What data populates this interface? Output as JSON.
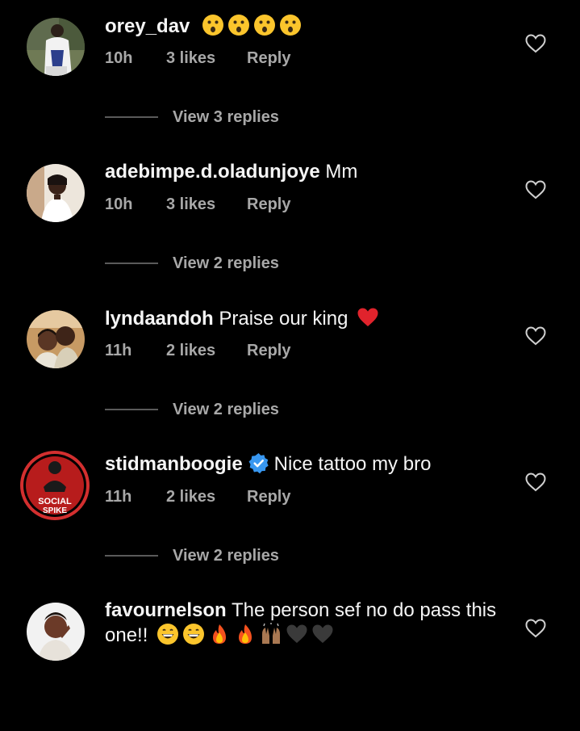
{
  "comments": [
    {
      "username": "orey_dav",
      "text": "",
      "emoji": [
        "hushed-face-icon",
        "hushed-face-icon",
        "hushed-face-icon",
        "hushed-face-icon"
      ],
      "time": "10h",
      "likes": "3 likes",
      "reply": "Reply",
      "view_replies": "View 3 replies"
    },
    {
      "username": "adebimpe.d.oladunjoye",
      "text": "Mm",
      "time": "10h",
      "likes": "3 likes",
      "reply": "Reply",
      "view_replies": "View 2 replies"
    },
    {
      "username": "lyndaandoh",
      "text": "Praise our king",
      "emoji": [
        "red-heart-icon"
      ],
      "time": "11h",
      "likes": "2 likes",
      "reply": "Reply",
      "view_replies": "View 2 replies"
    },
    {
      "username": "stidmanboogie",
      "verified": true,
      "avatar_text_line1": "SOCIAL",
      "avatar_text_line2": "SPIKE",
      "text": "Nice tattoo my bro",
      "time": "11h",
      "likes": "2 likes",
      "reply": "Reply",
      "view_replies": "View 2 replies"
    },
    {
      "username": "favournelson",
      "text_line1": "The person sef no do pass this",
      "text_line2": "one!!",
      "emoji": [
        "grinning-face-icon",
        "grinning-face-icon",
        "fire-icon",
        "fire-icon",
        "raising-hands-icon",
        "black-heart-icon",
        "black-heart-icon"
      ]
    }
  ],
  "colors": {
    "background": "#000000",
    "primary_text": "#f5f5f5",
    "secondary_text": "#a8a8a8",
    "verified_blue": "#3897f0",
    "story_ring": "#d32f2f"
  }
}
